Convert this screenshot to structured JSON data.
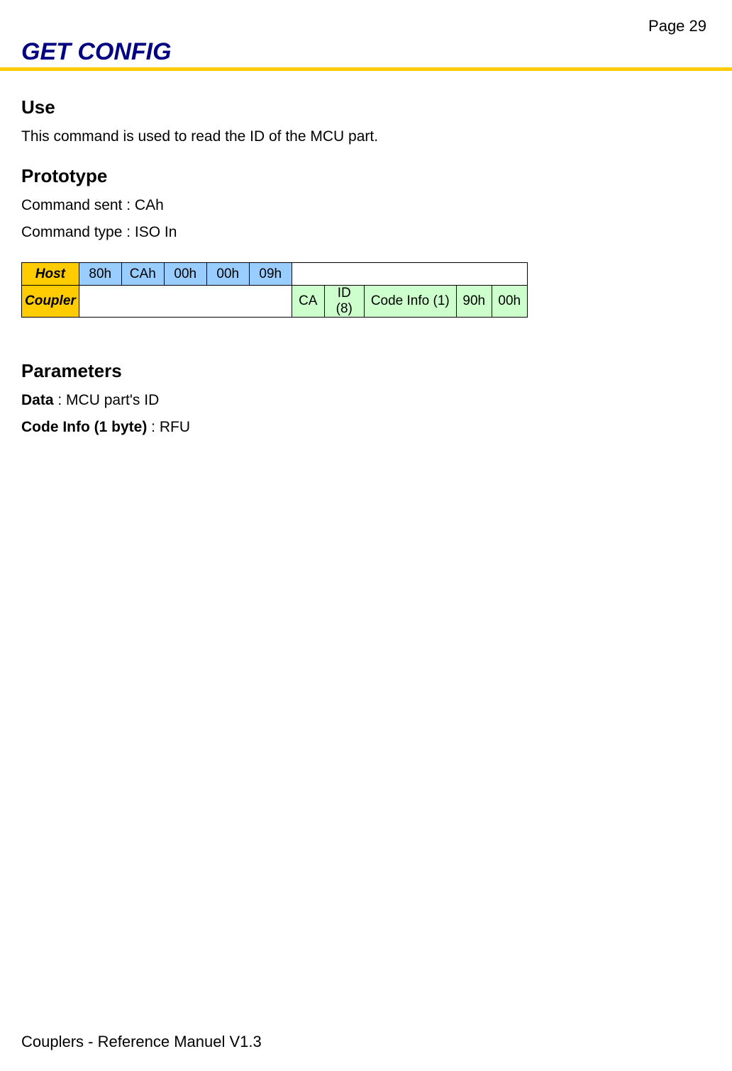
{
  "page_number": "Page 29",
  "title": "GET CONFIG",
  "sections": {
    "use": {
      "heading": "Use",
      "text": "This command is used to read the ID of the MCU part."
    },
    "prototype": {
      "heading": "Prototype",
      "line1": "Command sent : CAh",
      "line2": "Command type : ISO In"
    },
    "table": {
      "host_label": "Host",
      "coupler_label": "Coupler",
      "host_cells": [
        "80h",
        "CAh",
        "00h",
        "00h",
        "09h"
      ],
      "coupler_cells": [
        "CA",
        "ID (8)",
        "Code Info (1)",
        "90h",
        "00h"
      ]
    },
    "parameters": {
      "heading": "Parameters",
      "data_label": "Data",
      "data_sep": " : ",
      "data_value": "MCU part's ID",
      "code_label": "Code Info (1 byte)",
      "code_sep": " : ",
      "code_value": "RFU"
    }
  },
  "footer": "Couplers - Reference Manuel V1.3"
}
